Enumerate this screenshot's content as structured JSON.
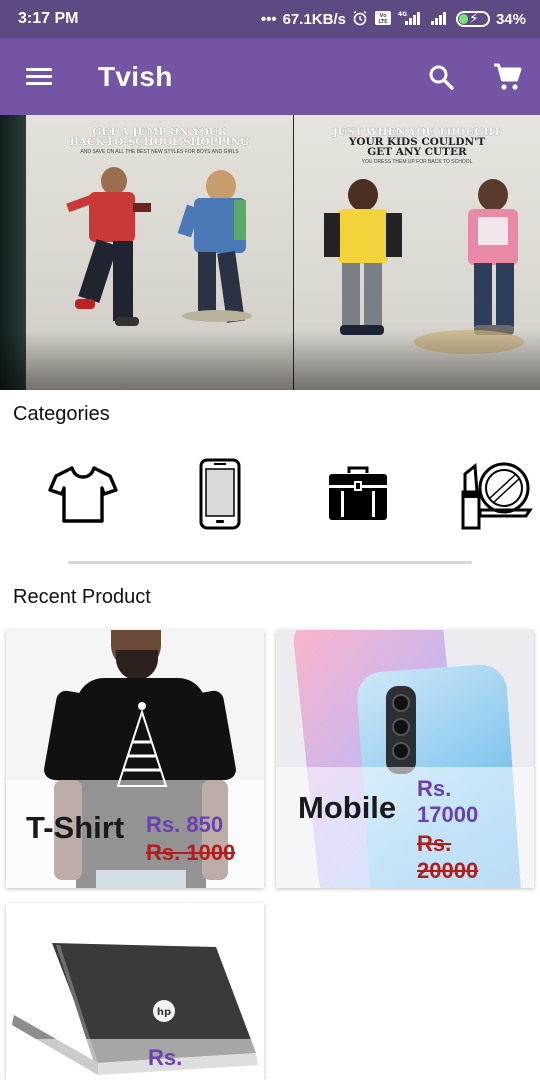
{
  "status_bar": {
    "time": "3:17 PM",
    "network_speed": "67.1KB/s",
    "network_type": "4G",
    "volte": "VoLTE",
    "battery": "34%"
  },
  "app_bar": {
    "title": "Tvish",
    "icons": [
      "menu-icon",
      "search-icon",
      "cart-icon"
    ]
  },
  "carousel": {
    "slide_1": {
      "headline_line1": "GET A JUMP ON YOUR",
      "headline_line2": "BACK-TO-SCHOOL SHOPPING",
      "subtext": "AND SAVE ON ALL THE BEST NEW STYLES FOR BOYS AND GIRLS"
    },
    "slide_2": {
      "headline_line1": "JUST WHEN YOU THOUGHT",
      "headline_line2": "YOUR KIDS COULDN'T",
      "headline_line3": "GET ANY CUTER",
      "subtext": "YOU DRESS THEM UP FOR BACK TO SCHOOL"
    },
    "dot_count": 6,
    "active_index": 2,
    "colors": {
      "dot": "#e879f9",
      "active_dot": "#ffffff"
    }
  },
  "categories": {
    "title": "Categories",
    "items": [
      "tshirt-icon",
      "mobile-icon",
      "briefcase-icon",
      "cosmetics-icon"
    ]
  },
  "recent": {
    "title": "Recent Product",
    "products": [
      {
        "name": "T-Shirt",
        "price": "Rs. 850",
        "old_price": "Rs. 1000"
      },
      {
        "name": "Mobile",
        "price_line1": "Rs.",
        "price_line2": "17000",
        "old_price_line1": "Rs.",
        "old_price_line2": "20000"
      },
      {
        "name": "",
        "price_line1": "Rs."
      }
    ]
  },
  "colors": {
    "status_bar": "#5e4a83",
    "app_bar": "#7454a4",
    "price": "#6b3fb0",
    "old_price": "#b71c1c"
  }
}
